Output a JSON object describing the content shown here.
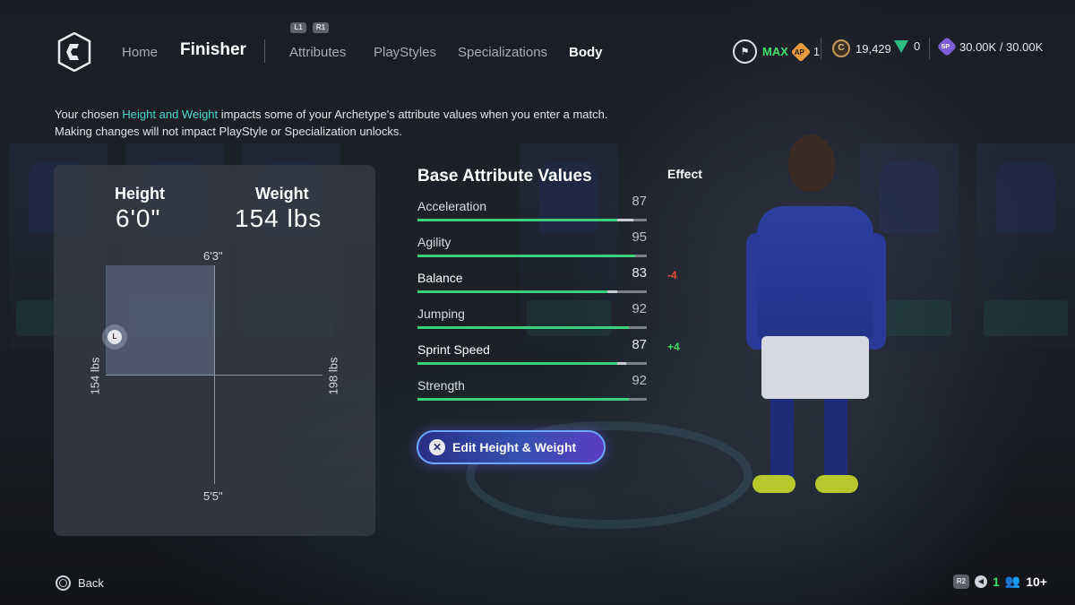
{
  "nav": {
    "home": "Home",
    "archetype": "Finisher",
    "tabs": [
      "Attributes",
      "PlayStyles",
      "Specializations",
      "Body"
    ],
    "active_tab": "Body",
    "hint_l1": "L1",
    "hint_r1": "R1"
  },
  "currencies": {
    "max_label": "MAX",
    "ap_icon": "AP",
    "ap_value": "1",
    "coin_icon": "C",
    "coins": "19,429",
    "points": "0",
    "sp_icon": "SP",
    "sp_value": "30.00K / 30.00K"
  },
  "intro": {
    "line1_pre": "Your chosen ",
    "line1_highlight": "Height and Weight",
    "line1_post": " impacts some of your Archetype's attribute values when you enter a match.",
    "line2": "Making changes will not impact PlayStyle or Specialization unlocks."
  },
  "body_panel": {
    "height_label": "Height",
    "height_value": "6'0\"",
    "weight_label": "Weight",
    "weight_value": "154 lbs",
    "axis_top": "6'3\"",
    "axis_bottom": "5'5\"",
    "axis_left": "154 lbs",
    "axis_right": "198 lbs",
    "handle_label": "L"
  },
  "attributes": {
    "title": "Base Attribute Values",
    "effect_title": "Effect",
    "items": [
      {
        "name": "Acceleration",
        "value": "87",
        "fill": 0.87,
        "ghost": 0.07,
        "effect": ""
      },
      {
        "name": "Agility",
        "value": "95",
        "fill": 0.95,
        "ghost": 0,
        "effect": ""
      },
      {
        "name": "Balance",
        "value": "83",
        "fill": 0.83,
        "ghost": 0.04,
        "effect": "-4"
      },
      {
        "name": "Jumping",
        "value": "92",
        "fill": 0.92,
        "ghost": 0,
        "effect": ""
      },
      {
        "name": "Sprint Speed",
        "value": "87",
        "fill": 0.87,
        "ghost": 0.04,
        "effect": "+4"
      },
      {
        "name": "Strength",
        "value": "92",
        "fill": 0.92,
        "ghost": 0,
        "effect": ""
      }
    ]
  },
  "edit_button": {
    "label": "Edit Height & Weight",
    "icon": "cross-button-icon"
  },
  "footer": {
    "back_label": "Back",
    "r2_badge": "R2",
    "speaker_count": "1",
    "users_count": "10+"
  },
  "colors": {
    "accent_teal": "#47d8d0",
    "bar_green": "#38d27a",
    "negative": "#e8503a",
    "positive": "#38dc62"
  }
}
